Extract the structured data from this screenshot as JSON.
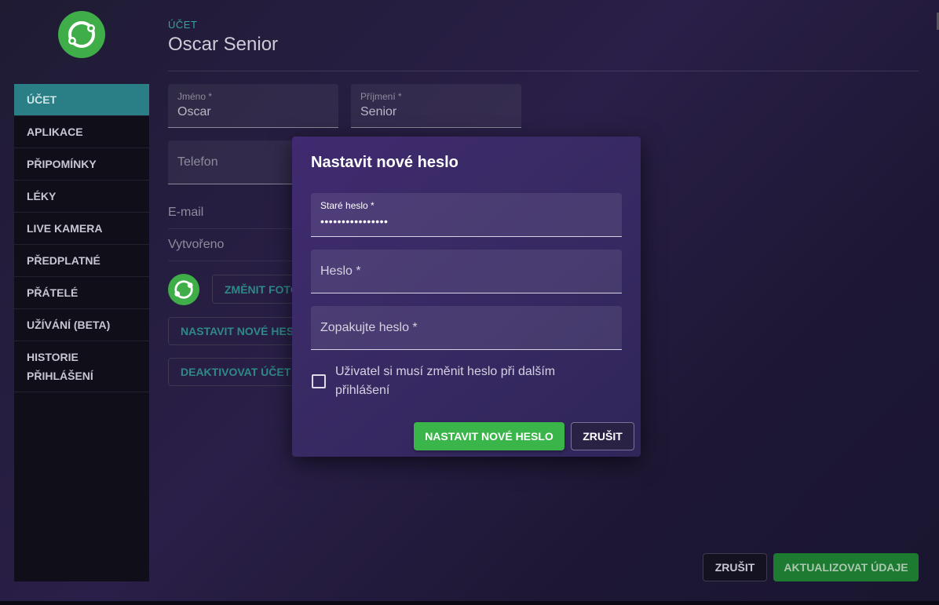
{
  "header": {
    "section_label": "ÚČET",
    "title": "Oscar Senior"
  },
  "sidebar": {
    "items": [
      {
        "label": "ÚČET"
      },
      {
        "label": "APLIKACE"
      },
      {
        "label": "PŘIPOMÍNKY"
      },
      {
        "label": "LÉKY"
      },
      {
        "label": "LIVE KAMERA"
      },
      {
        "label": "PŘEDPLATNÉ"
      },
      {
        "label": "PŘÁTELÉ"
      },
      {
        "label": "UŽÍVÁNÍ (BETA)"
      },
      {
        "label_line1": "HISTORIE",
        "label_line2": "PŘIHLÁŠENÍ"
      }
    ]
  },
  "form": {
    "first_name": {
      "label": "Jméno *",
      "value": "Oscar"
    },
    "last_name": {
      "label": "Příjmení *",
      "value": "Senior"
    },
    "phone": {
      "placeholder": "Telefon"
    },
    "email_label": "E-mail",
    "created_label": "Vytvořeno",
    "change_photo_button": "ZMĚNIT FOTO",
    "set_password_button": "NASTAVIT NOVÉ HESLO",
    "deactivate_button": "DEAKTIVOVAT ÚČET"
  },
  "footer": {
    "cancel_label": "ZRUŠIT",
    "update_label": "AKTUALIZOVAT ÚDAJE"
  },
  "modal": {
    "title": "Nastavit nové heslo",
    "old_password": {
      "label": "Staré heslo *",
      "value": "••••••••••••••••"
    },
    "new_password": {
      "placeholder": "Heslo *"
    },
    "repeat_password": {
      "placeholder": "Zopakujte heslo *"
    },
    "force_change": {
      "label": "Uživatel si musí změnit heslo při dalším přihlášení",
      "checked": false
    },
    "confirm_label": "NASTAVIT NOVÉ HESLO",
    "cancel_label": "ZRUŠIT"
  },
  "colors": {
    "accent_teal": "#2a7e86",
    "brand_green": "#3ab54a",
    "modal_bg": "#3a2a66"
  },
  "icons": {
    "logo": "app-logo-icon"
  }
}
